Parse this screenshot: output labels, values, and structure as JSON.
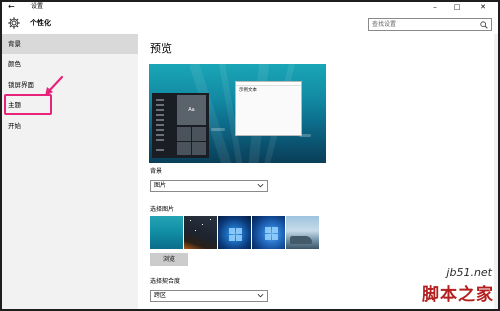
{
  "window": {
    "app_title": "设置",
    "back": "←",
    "min": "–",
    "max": "□",
    "close": "✕"
  },
  "header": {
    "title": "个性化",
    "search_placeholder": "查找设置"
  },
  "sidebar": {
    "items": [
      {
        "label": "背景",
        "active": true
      },
      {
        "label": "颜色",
        "active": false
      },
      {
        "label": "锁屏界面",
        "active": false
      },
      {
        "label": "主题",
        "active": false
      },
      {
        "label": "开始",
        "active": false
      }
    ],
    "highlight_color": "#e8237a"
  },
  "main": {
    "section_title": "预览",
    "preview": {
      "tile_text": "Aa",
      "sample_text": "示例文本"
    },
    "background_label": "背景",
    "background_value": "图片",
    "choose_picture_label": "选择图片",
    "thumbnails": [
      "thumb-1",
      "thumb-2",
      "thumb-3",
      "thumb-4",
      "thumb-5"
    ],
    "browse_label": "浏览",
    "fit_label": "选择契合度",
    "fit_value": "跨区"
  },
  "watermark": {
    "site": "jb51.net",
    "name": "脚本之家"
  },
  "colors": {
    "accent_pink": "#e8237a",
    "sidebar_bg": "#f2f2f2",
    "selected_bg": "#d9d9d9",
    "watermark_red": "#b42020"
  }
}
